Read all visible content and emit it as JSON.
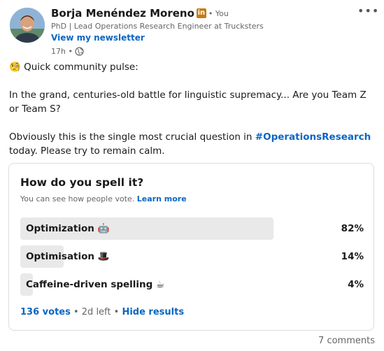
{
  "author": {
    "name": "Borja Menéndez Moreno",
    "badge": "in",
    "relation": "• You",
    "headline": "PhD | Lead Operations Research Engineer at Trucksters",
    "newsletter_link": "View my newsletter",
    "timestamp": "17h •"
  },
  "post": {
    "line1": "🧐 Quick community pulse:",
    "line2": "In the grand, centuries-old battle for linguistic supremacy... Are you Team Z or Team S?",
    "line3_prefix": "Obviously this is the single most crucial question in ",
    "hashtag": "#OperationsResearch",
    "line3_suffix": " today. Please try to remain calm."
  },
  "poll": {
    "question": "How do you spell it?",
    "notice": "You can see how people vote.",
    "learn_more": "Learn more",
    "options": [
      {
        "label": "Optimization 🤖",
        "percent_label": "82%",
        "percent": 82
      },
      {
        "label": "Optimisation 🎩",
        "percent_label": "14%",
        "percent": 14
      },
      {
        "label": "Caffeine-driven spelling ☕",
        "percent_label": "4%",
        "percent": 4
      }
    ],
    "votes": "136 votes",
    "time_left": "• 2d left •",
    "hide_results": "Hide results"
  },
  "comments": "7 comments",
  "icons": {
    "more": "more-options-icon",
    "globe": "globe-icon"
  },
  "colors": {
    "link": "#0a66c2",
    "bar": "#e9e9e9",
    "badge": "#c37d16"
  }
}
